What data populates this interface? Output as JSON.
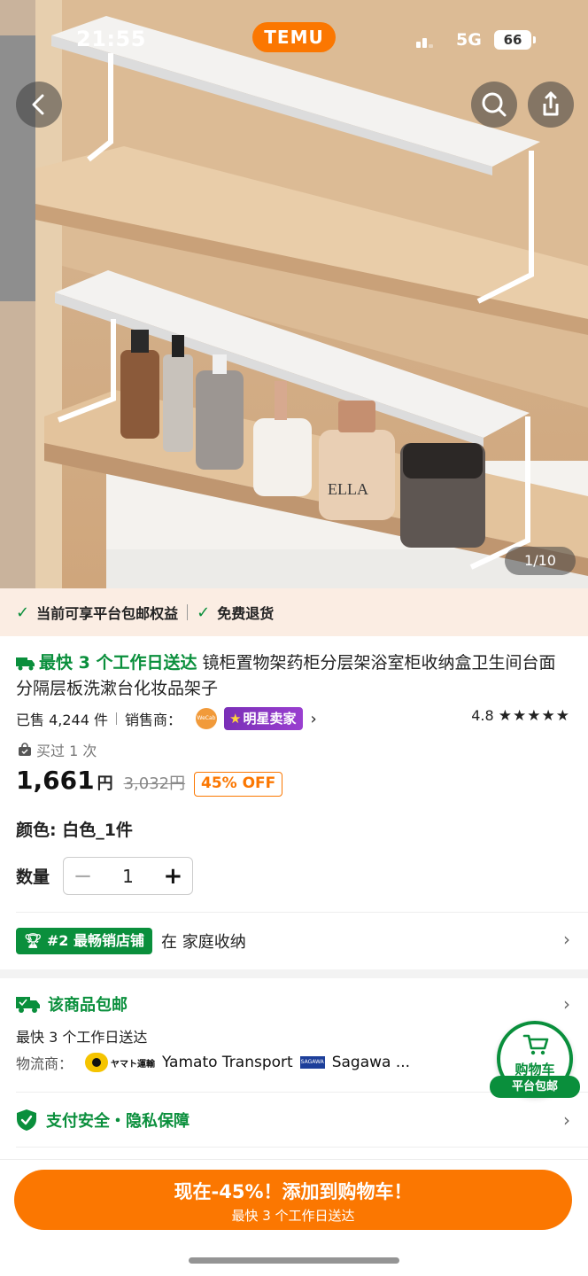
{
  "status": {
    "time": "21:55",
    "brand": "TEMU",
    "network": "5G",
    "battery": "66"
  },
  "gallery": {
    "pager": "1/10",
    "jar_label": "ELLA"
  },
  "benefits": {
    "item1": "当前可享平台包邮权益",
    "item2": "免费退货"
  },
  "product": {
    "fast_delivery": "最快 3 个工作日送达",
    "title": "镜柜置物架药柜分层架浴室柜收纳盒卫生间台面分隔层板洗漱台化妆品架子",
    "sold": "已售 4,244 件",
    "seller_label": "销售商：",
    "seller_logo": "WeCab eHome",
    "seller_badge": "明星卖家",
    "rating": "4.8",
    "stars": "★★★★★",
    "bought_before": "买过 1 次",
    "price": "1,661",
    "currency": "円",
    "original_price": "3,032円",
    "discount": "45% OFF",
    "color_label": "颜色: 白色_1件",
    "qty_label": "数量",
    "qty": "1"
  },
  "bestseller": {
    "badge": "#2 最畅销店铺",
    "text": "在 家庭收纳"
  },
  "shipping": {
    "title": "该商品包邮",
    "days": "最快 3 个工作日送达",
    "carrier_label": "物流商：",
    "carrier_jp": "ヤマト運輸",
    "carrier1": "Yamato Transport",
    "carrier2_logo": "SAGAWA",
    "carrier2": "Sagawa ..."
  },
  "payment": {
    "text": "支付安全・隐私保障"
  },
  "cart": {
    "label": "购物车",
    "tag": "平台包邮"
  },
  "cta": {
    "line1": "现在-45%！添加到购物车！",
    "line2": "最快 3 个工作日送达"
  },
  "colors": {
    "brand_orange": "#fb7701",
    "green": "#0a8f3c",
    "benefit_bg": "#fbede3"
  }
}
